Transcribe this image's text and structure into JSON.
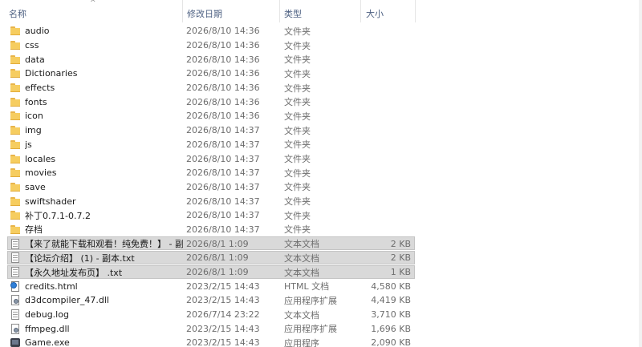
{
  "columns": {
    "name": "名称",
    "date": "修改日期",
    "type": "类型",
    "size": "大小",
    "sort_indicator": "^"
  },
  "files": [
    {
      "name": "audio",
      "date": "2026/8/10 14:36",
      "type": "文件夹",
      "size": "",
      "icon": "folder-icon",
      "selected": false
    },
    {
      "name": "css",
      "date": "2026/8/10 14:36",
      "type": "文件夹",
      "size": "",
      "icon": "folder-icon",
      "selected": false
    },
    {
      "name": "data",
      "date": "2026/8/10 14:36",
      "type": "文件夹",
      "size": "",
      "icon": "folder-icon",
      "selected": false
    },
    {
      "name": "Dictionaries",
      "date": "2026/8/10 14:36",
      "type": "文件夹",
      "size": "",
      "icon": "folder-icon",
      "selected": false
    },
    {
      "name": "effects",
      "date": "2026/8/10 14:36",
      "type": "文件夹",
      "size": "",
      "icon": "folder-icon",
      "selected": false
    },
    {
      "name": "fonts",
      "date": "2026/8/10 14:36",
      "type": "文件夹",
      "size": "",
      "icon": "folder-icon",
      "selected": false
    },
    {
      "name": "icon",
      "date": "2026/8/10 14:36",
      "type": "文件夹",
      "size": "",
      "icon": "folder-icon",
      "selected": false
    },
    {
      "name": "img",
      "date": "2026/8/10 14:37",
      "type": "文件夹",
      "size": "",
      "icon": "folder-icon",
      "selected": false
    },
    {
      "name": "js",
      "date": "2026/8/10 14:37",
      "type": "文件夹",
      "size": "",
      "icon": "folder-icon",
      "selected": false
    },
    {
      "name": "locales",
      "date": "2026/8/10 14:37",
      "type": "文件夹",
      "size": "",
      "icon": "folder-icon",
      "selected": false
    },
    {
      "name": "movies",
      "date": "2026/8/10 14:37",
      "type": "文件夹",
      "size": "",
      "icon": "folder-icon",
      "selected": false
    },
    {
      "name": "save",
      "date": "2026/8/10 14:37",
      "type": "文件夹",
      "size": "",
      "icon": "folder-icon",
      "selected": false
    },
    {
      "name": "swiftshader",
      "date": "2026/8/10 14:37",
      "type": "文件夹",
      "size": "",
      "icon": "folder-icon",
      "selected": false
    },
    {
      "name": "补丁0.7.1-0.7.2",
      "date": "2026/8/10 14:37",
      "type": "文件夹",
      "size": "",
      "icon": "folder-icon",
      "selected": false
    },
    {
      "name": "存档",
      "date": "2026/8/10 14:37",
      "type": "文件夹",
      "size": "",
      "icon": "folder-icon",
      "selected": false
    },
    {
      "name": "【来了就能下载和观看！纯免费！】 - 副...",
      "date": "2026/8/1 1:09",
      "type": "文本文档",
      "size": "2 KB",
      "icon": "text-file-icon",
      "selected": true
    },
    {
      "name": "【论坛介绍】 (1) - 副本.txt",
      "date": "2026/8/1 1:09",
      "type": "文本文档",
      "size": "2 KB",
      "icon": "text-file-icon",
      "selected": true
    },
    {
      "name": "【永久地址发布页】 .txt",
      "date": "2026/8/1 1:09",
      "type": "文本文档",
      "size": "1 KB",
      "icon": "text-file-icon",
      "selected": true
    },
    {
      "name": "credits.html",
      "date": "2023/2/15 14:43",
      "type": "HTML 文档",
      "size": "4,580 KB",
      "icon": "html-file-icon",
      "selected": false
    },
    {
      "name": "d3dcompiler_47.dll",
      "date": "2023/2/15 14:43",
      "type": "应用程序扩展",
      "size": "4,419 KB",
      "icon": "dll-file-icon",
      "selected": false
    },
    {
      "name": "debug.log",
      "date": "2026/7/14 23:22",
      "type": "文本文档",
      "size": "3,710 KB",
      "icon": "text-file-icon",
      "selected": false
    },
    {
      "name": "ffmpeg.dll",
      "date": "2023/2/15 14:43",
      "type": "应用程序扩展",
      "size": "1,696 KB",
      "icon": "dll-file-icon",
      "selected": false
    },
    {
      "name": "Game.exe",
      "date": "2023/2/15 14:43",
      "type": "应用程序",
      "size": "2,090 KB",
      "icon": "exe-icon",
      "selected": false
    }
  ]
}
